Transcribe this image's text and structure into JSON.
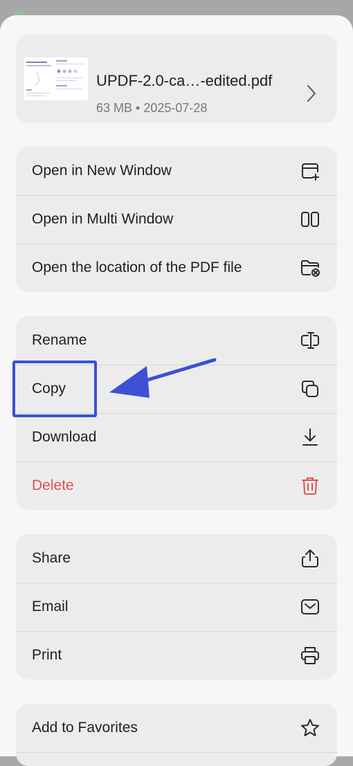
{
  "file": {
    "name": "UPDF-2.0-ca…-edited.pdf",
    "meta": "63 MB • 2025-07-28"
  },
  "groups": {
    "open": [
      {
        "label": "Open in New Window",
        "icon": "new-window-icon"
      },
      {
        "label": "Open in Multi Window",
        "icon": "split-window-icon"
      },
      {
        "label": "Open the location of the PDF file",
        "icon": "folder-location-icon"
      }
    ],
    "manage": [
      {
        "label": "Rename",
        "icon": "rename-icon"
      },
      {
        "label": "Copy",
        "icon": "copy-icon"
      },
      {
        "label": "Download",
        "icon": "download-icon"
      },
      {
        "label": "Delete",
        "icon": "trash-icon"
      }
    ],
    "share": [
      {
        "label": "Share",
        "icon": "share-icon"
      },
      {
        "label": "Email",
        "icon": "mail-icon"
      },
      {
        "label": "Print",
        "icon": "printer-icon"
      }
    ],
    "extra": [
      {
        "label": "Add to Favorites",
        "icon": "star-icon"
      }
    ]
  },
  "colors": {
    "danger": "#e05050",
    "annotation": "#3d4fd4"
  }
}
